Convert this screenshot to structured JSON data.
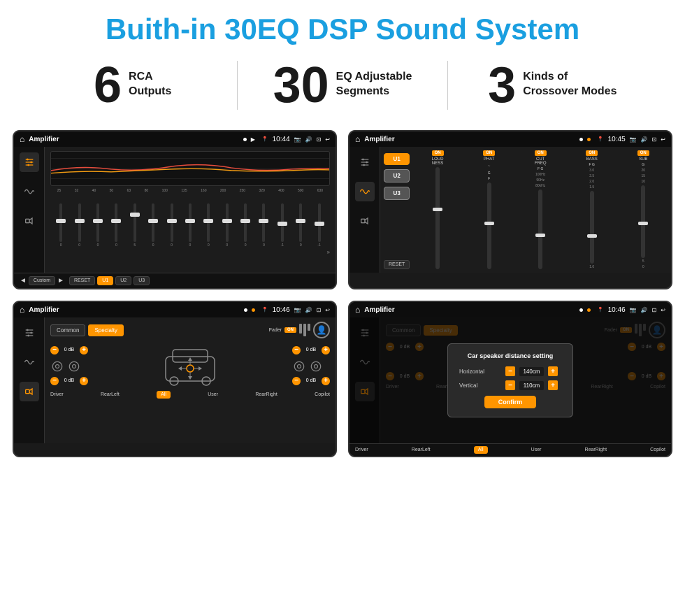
{
  "header": {
    "title": "Buith-in 30EQ DSP Sound System"
  },
  "stats": [
    {
      "number": "6",
      "label": "RCA\nOutputs"
    },
    {
      "number": "30",
      "label": "EQ Adjustable\nSegments"
    },
    {
      "number": "3",
      "label": "Kinds of\nCrossover Modes"
    }
  ],
  "screens": [
    {
      "id": "eq-screen",
      "statusBar": {
        "title": "Amplifier",
        "time": "10:44",
        "mode": "play"
      },
      "type": "eq"
    },
    {
      "id": "amp-screen",
      "statusBar": {
        "title": "Amplifier",
        "time": "10:45",
        "mode": "grid"
      },
      "type": "amplifier"
    },
    {
      "id": "crossover-screen",
      "statusBar": {
        "title": "Amplifier",
        "time": "10:46",
        "mode": "grid"
      },
      "type": "crossover"
    },
    {
      "id": "distance-screen",
      "statusBar": {
        "title": "Amplifier",
        "time": "10:46",
        "mode": "grid"
      },
      "type": "distance",
      "dialog": {
        "title": "Car speaker distance setting",
        "horizontal": {
          "label": "Horizontal",
          "value": "140cm"
        },
        "vertical": {
          "label": "Vertical",
          "value": "110cm"
        },
        "confirmLabel": "Confirm"
      }
    }
  ],
  "eq": {
    "frequencies": [
      "25",
      "32",
      "40",
      "50",
      "63",
      "80",
      "100",
      "125",
      "160",
      "200",
      "250",
      "320",
      "400",
      "500",
      "630"
    ],
    "values": [
      "0",
      "0",
      "0",
      "0",
      "5",
      "0",
      "0",
      "0",
      "0",
      "0",
      "0",
      "0",
      "-1",
      "0",
      "-1"
    ],
    "thumbPositions": [
      50,
      50,
      50,
      50,
      30,
      50,
      50,
      50,
      50,
      50,
      50,
      50,
      55,
      50,
      55
    ],
    "buttons": {
      "prev": "◄",
      "preset": "Custom",
      "next": "►",
      "reset": "RESET",
      "u1": "U1",
      "u2": "U2",
      "u3": "U3"
    }
  },
  "amplifier": {
    "uButtons": [
      "U1",
      "U2",
      "U3"
    ],
    "channels": [
      {
        "label": "LOUDNESS",
        "on": true
      },
      {
        "label": "PHAT",
        "on": true
      },
      {
        "label": "CUT FREQ",
        "on": true
      },
      {
        "label": "BASS",
        "on": true
      },
      {
        "label": "SUB",
        "on": true
      }
    ],
    "resetLabel": "RESET"
  },
  "crossover": {
    "tabs": [
      "Common",
      "Specialty"
    ],
    "faderLabel": "Fader",
    "faderOn": "ON",
    "labels": {
      "topLeft": "0 dB",
      "topRight": "0 dB",
      "bottomLeft": "0 dB",
      "bottomRight": "0 dB"
    },
    "bottomLabels": [
      "Driver",
      "RearLeft",
      "All",
      "User",
      "RearRight",
      "Copilot"
    ]
  },
  "distance": {
    "tabs": [
      "Common",
      "Specialty"
    ],
    "labels": {
      "topLeft": "0 dB",
      "topRight": "0 dB",
      "bottomLeft": "0 dB",
      "bottomRight": "0 dB"
    },
    "dialog": {
      "title": "Car speaker distance setting",
      "horizontalLabel": "Horizontal",
      "horizontalValue": "140cm",
      "verticalLabel": "Vertical",
      "verticalValue": "110cm",
      "confirmLabel": "Confirm"
    },
    "bottomLabels": [
      "Driver",
      "RearLeft",
      "All",
      "User",
      "RearRight",
      "Copilot"
    ]
  }
}
